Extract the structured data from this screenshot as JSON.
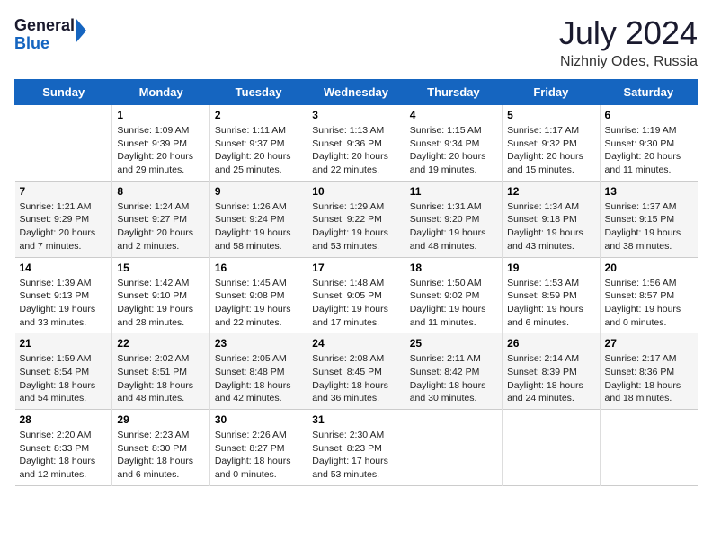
{
  "header": {
    "logo_line1": "General",
    "logo_line2": "Blue",
    "month_year": "July 2024",
    "location": "Nizhniy Odes, Russia"
  },
  "weekdays": [
    "Sunday",
    "Monday",
    "Tuesday",
    "Wednesday",
    "Thursday",
    "Friday",
    "Saturday"
  ],
  "rows": [
    [
      {
        "day": "",
        "info": ""
      },
      {
        "day": "1",
        "info": "Sunrise: 1:09 AM\nSunset: 9:39 PM\nDaylight: 20 hours\nand 29 minutes."
      },
      {
        "day": "2",
        "info": "Sunrise: 1:11 AM\nSunset: 9:37 PM\nDaylight: 20 hours\nand 25 minutes."
      },
      {
        "day": "3",
        "info": "Sunrise: 1:13 AM\nSunset: 9:36 PM\nDaylight: 20 hours\nand 22 minutes."
      },
      {
        "day": "4",
        "info": "Sunrise: 1:15 AM\nSunset: 9:34 PM\nDaylight: 20 hours\nand 19 minutes."
      },
      {
        "day": "5",
        "info": "Sunrise: 1:17 AM\nSunset: 9:32 PM\nDaylight: 20 hours\nand 15 minutes."
      },
      {
        "day": "6",
        "info": "Sunrise: 1:19 AM\nSunset: 9:30 PM\nDaylight: 20 hours\nand 11 minutes."
      }
    ],
    [
      {
        "day": "7",
        "info": "Sunrise: 1:21 AM\nSunset: 9:29 PM\nDaylight: 20 hours\nand 7 minutes."
      },
      {
        "day": "8",
        "info": "Sunrise: 1:24 AM\nSunset: 9:27 PM\nDaylight: 20 hours\nand 2 minutes."
      },
      {
        "day": "9",
        "info": "Sunrise: 1:26 AM\nSunset: 9:24 PM\nDaylight: 19 hours\nand 58 minutes."
      },
      {
        "day": "10",
        "info": "Sunrise: 1:29 AM\nSunset: 9:22 PM\nDaylight: 19 hours\nand 53 minutes."
      },
      {
        "day": "11",
        "info": "Sunrise: 1:31 AM\nSunset: 9:20 PM\nDaylight: 19 hours\nand 48 minutes."
      },
      {
        "day": "12",
        "info": "Sunrise: 1:34 AM\nSunset: 9:18 PM\nDaylight: 19 hours\nand 43 minutes."
      },
      {
        "day": "13",
        "info": "Sunrise: 1:37 AM\nSunset: 9:15 PM\nDaylight: 19 hours\nand 38 minutes."
      }
    ],
    [
      {
        "day": "14",
        "info": "Sunrise: 1:39 AM\nSunset: 9:13 PM\nDaylight: 19 hours\nand 33 minutes."
      },
      {
        "day": "15",
        "info": "Sunrise: 1:42 AM\nSunset: 9:10 PM\nDaylight: 19 hours\nand 28 minutes."
      },
      {
        "day": "16",
        "info": "Sunrise: 1:45 AM\nSunset: 9:08 PM\nDaylight: 19 hours\nand 22 minutes."
      },
      {
        "day": "17",
        "info": "Sunrise: 1:48 AM\nSunset: 9:05 PM\nDaylight: 19 hours\nand 17 minutes."
      },
      {
        "day": "18",
        "info": "Sunrise: 1:50 AM\nSunset: 9:02 PM\nDaylight: 19 hours\nand 11 minutes."
      },
      {
        "day": "19",
        "info": "Sunrise: 1:53 AM\nSunset: 8:59 PM\nDaylight: 19 hours\nand 6 minutes."
      },
      {
        "day": "20",
        "info": "Sunrise: 1:56 AM\nSunset: 8:57 PM\nDaylight: 19 hours\nand 0 minutes."
      }
    ],
    [
      {
        "day": "21",
        "info": "Sunrise: 1:59 AM\nSunset: 8:54 PM\nDaylight: 18 hours\nand 54 minutes."
      },
      {
        "day": "22",
        "info": "Sunrise: 2:02 AM\nSunset: 8:51 PM\nDaylight: 18 hours\nand 48 minutes."
      },
      {
        "day": "23",
        "info": "Sunrise: 2:05 AM\nSunset: 8:48 PM\nDaylight: 18 hours\nand 42 minutes."
      },
      {
        "day": "24",
        "info": "Sunrise: 2:08 AM\nSunset: 8:45 PM\nDaylight: 18 hours\nand 36 minutes."
      },
      {
        "day": "25",
        "info": "Sunrise: 2:11 AM\nSunset: 8:42 PM\nDaylight: 18 hours\nand 30 minutes."
      },
      {
        "day": "26",
        "info": "Sunrise: 2:14 AM\nSunset: 8:39 PM\nDaylight: 18 hours\nand 24 minutes."
      },
      {
        "day": "27",
        "info": "Sunrise: 2:17 AM\nSunset: 8:36 PM\nDaylight: 18 hours\nand 18 minutes."
      }
    ],
    [
      {
        "day": "28",
        "info": "Sunrise: 2:20 AM\nSunset: 8:33 PM\nDaylight: 18 hours\nand 12 minutes."
      },
      {
        "day": "29",
        "info": "Sunrise: 2:23 AM\nSunset: 8:30 PM\nDaylight: 18 hours\nand 6 minutes."
      },
      {
        "day": "30",
        "info": "Sunrise: 2:26 AM\nSunset: 8:27 PM\nDaylight: 18 hours\nand 0 minutes."
      },
      {
        "day": "31",
        "info": "Sunrise: 2:30 AM\nSunset: 8:23 PM\nDaylight: 17 hours\nand 53 minutes."
      },
      {
        "day": "",
        "info": ""
      },
      {
        "day": "",
        "info": ""
      },
      {
        "day": "",
        "info": ""
      }
    ]
  ]
}
